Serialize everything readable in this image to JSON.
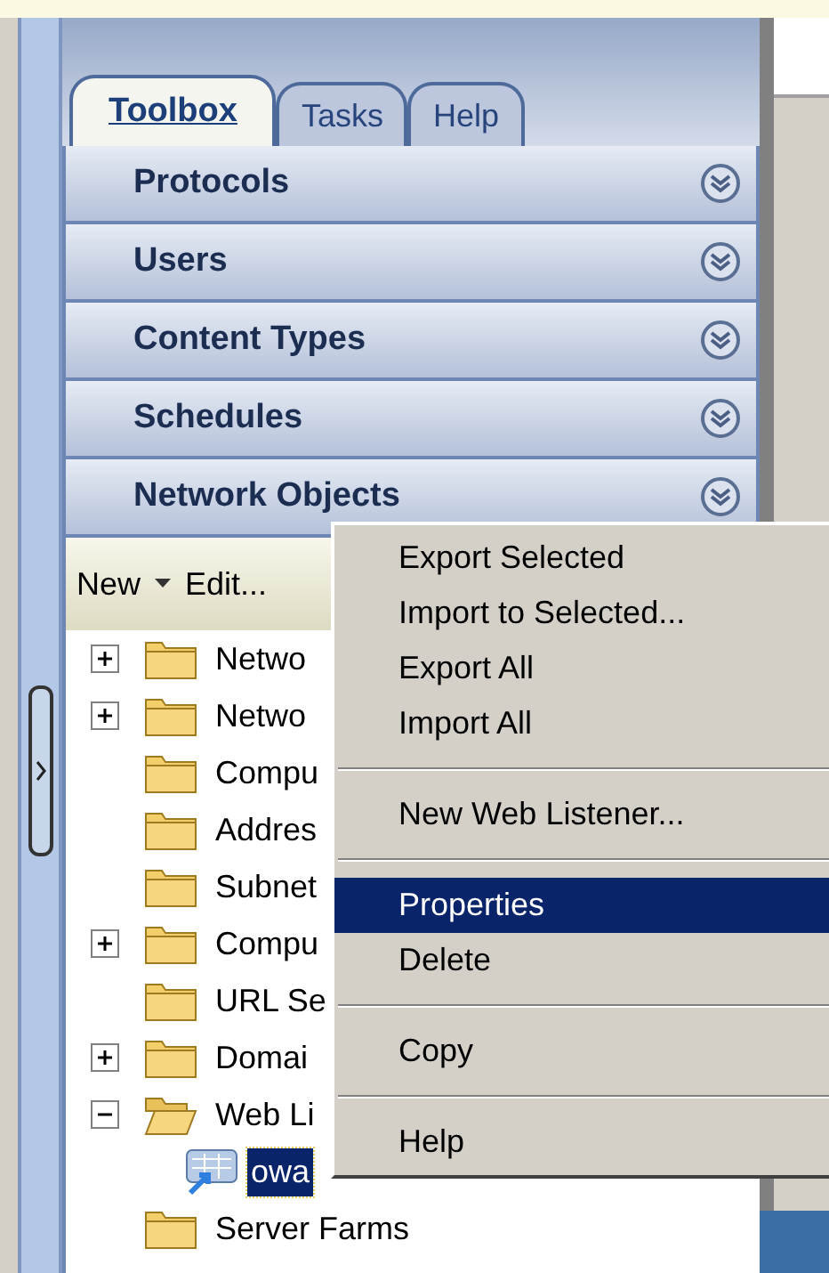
{
  "tabs": [
    {
      "label": "Toolbox",
      "selected": true
    },
    {
      "label": "Tasks",
      "selected": false
    },
    {
      "label": "Help",
      "selected": false
    }
  ],
  "sections": [
    {
      "label": "Protocols"
    },
    {
      "label": "Users"
    },
    {
      "label": "Content Types"
    },
    {
      "label": "Schedules"
    },
    {
      "label": "Network Objects"
    }
  ],
  "toolbar": {
    "new": "New",
    "edit": "Edit..."
  },
  "tree": [
    {
      "label": "Netwo",
      "expanded": false
    },
    {
      "label": "Netwo",
      "expanded": false
    },
    {
      "label": "Compu"
    },
    {
      "label": "Addres"
    },
    {
      "label": "Subnet"
    },
    {
      "label": "Compu",
      "expanded": false
    },
    {
      "label": "URL Se"
    },
    {
      "label": "Domai",
      "expanded": false
    },
    {
      "label": "Web Li",
      "expanded": true,
      "children": [
        {
          "label": "owa",
          "selected": true
        }
      ]
    },
    {
      "label": "Server Farms"
    }
  ],
  "context_menu": [
    {
      "kind": "item",
      "label": "Export Selected",
      "selected": false
    },
    {
      "kind": "item",
      "label": "Import to Selected...",
      "selected": false
    },
    {
      "kind": "item",
      "label": "Export All",
      "selected": false
    },
    {
      "kind": "item",
      "label": "Import All",
      "selected": false
    },
    {
      "kind": "separator"
    },
    {
      "kind": "item",
      "label": "New Web Listener...",
      "selected": false
    },
    {
      "kind": "separator"
    },
    {
      "kind": "item",
      "label": "Properties",
      "selected": true
    },
    {
      "kind": "item",
      "label": "Delete",
      "selected": false
    },
    {
      "kind": "separator"
    },
    {
      "kind": "item",
      "label": "Copy",
      "selected": false
    },
    {
      "kind": "separator"
    },
    {
      "kind": "item",
      "label": "Help",
      "selected": false
    }
  ]
}
